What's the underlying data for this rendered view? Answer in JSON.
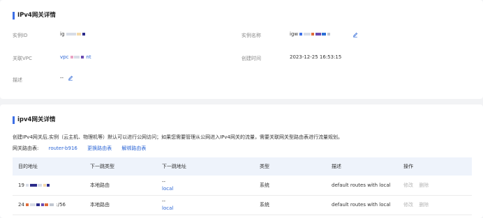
{
  "basic": {
    "title": "IPv4网关详情",
    "instance_id_label": "实例ID",
    "instance_id_value": "ig",
    "instance_name_label": "实例名称",
    "instance_name_value": "igw",
    "vpc_label": "关联VPC",
    "vpc_value_prefix": "vpc",
    "vpc_value_suffix": "nt",
    "created_label": "创建时间",
    "created_value": "2023-12-25 16:53:15",
    "desc_label": "描述",
    "desc_value": "--"
  },
  "detail": {
    "title": "ipv4网关详情",
    "description": "创建IPv4网关后,实例（云主机、物理机等）默认可以进行公网访问；如果您需要管理从公网进入IPv4网关的流量，需要关联网关型路由表进行流量规划。",
    "route_table_label": "网关路由表:",
    "route_table_value": "router-b916",
    "change_route_table": "更换路由表",
    "unbind_route_table": "解绑路由表",
    "columns": [
      "目的地址",
      "下一跳类型",
      "下一跳地址",
      "类型",
      "描述",
      "操作"
    ],
    "rows": [
      {
        "dest": "19",
        "hop_type": "本地路由",
        "hop_addr_top": "--",
        "hop_addr_bottom": "local",
        "type": "系统",
        "desc": "default routes with local",
        "op_edit": "修改",
        "op_delete": "删除"
      },
      {
        "dest_prefix": "24",
        "dest_suffix": ":/56",
        "hop_type": "本地路由",
        "hop_addr_top": "--",
        "hop_addr_bottom": "local",
        "type": "系统",
        "desc": "default routes with local",
        "op_edit": "修改",
        "op_delete": "删除"
      }
    ]
  },
  "colors": {
    "accent": "#3d6fe6",
    "link": "#2c66d6",
    "header_bg": "#eef3fb",
    "disabled": "#b5b5b5"
  },
  "icons": [
    "edit-icon"
  ]
}
